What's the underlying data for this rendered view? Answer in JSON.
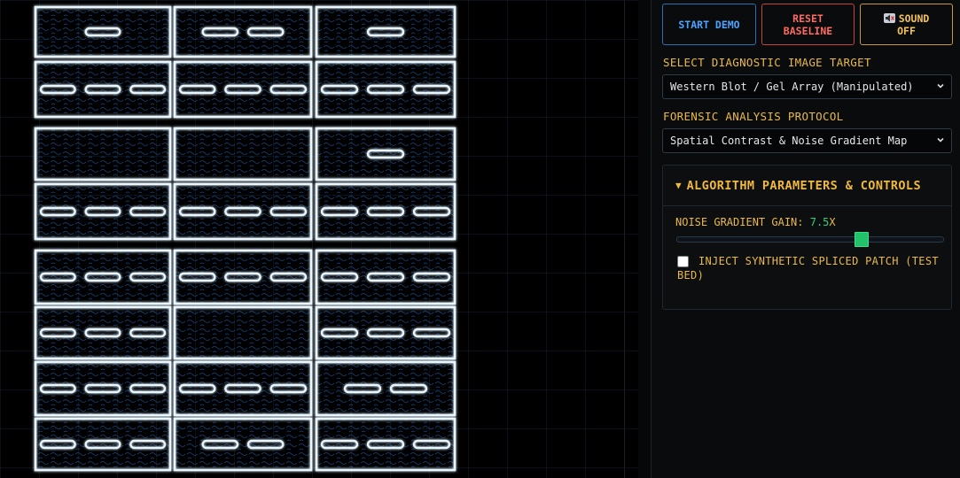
{
  "controls": {
    "start_demo": "START DEMO",
    "reset_baseline_l1": "RESET",
    "reset_baseline_l2": "BASELINE",
    "sound_l1": "SOUND",
    "sound_l2": "OFF",
    "sound_icon": "muted-speaker-icon"
  },
  "target": {
    "label": "SELECT DIAGNOSTIC IMAGE TARGET",
    "selected": "Western Blot / Gel Array (Manipulated)"
  },
  "protocol": {
    "label": "FORENSIC ANALYSIS PROTOCOL",
    "selected": "Spatial Contrast & Noise Gradient Map"
  },
  "parameters": {
    "title": "ALGORITHM PARAMETERS & CONTROLS",
    "expanded": true,
    "gain_label": "NOISE GRADIENT GAIN:",
    "gain_value": "7.5",
    "gain_unit": "X",
    "gain_fraction": 0.7,
    "inject_label_l1": "INJECT SYNTHETIC SPLICED PATCH (TEST",
    "inject_label_l2": "BED)",
    "inject_checked": false
  },
  "blot": {
    "columns": 3,
    "rows": 8,
    "row_bands": [
      [
        1,
        2,
        1
      ],
      [
        3,
        3,
        3
      ],
      [
        0,
        0,
        1
      ],
      [
        3,
        3,
        3
      ],
      [
        3,
        3,
        3
      ],
      [
        3,
        0,
        3
      ],
      [
        3,
        3,
        2
      ],
      [
        3,
        2,
        3
      ]
    ],
    "colors": {
      "stroke": "#4aa8ff",
      "glow": "#e8f6ff",
      "dim": "#1a5fb0"
    }
  }
}
